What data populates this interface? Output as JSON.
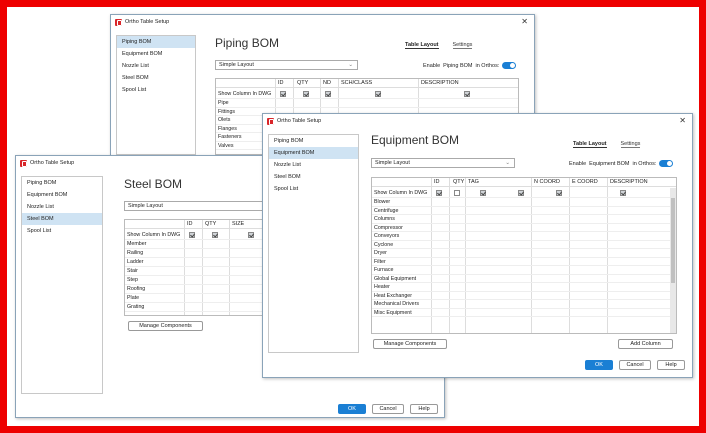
{
  "app_title": "Ortho Table Setup",
  "nav": [
    "Piping BOM",
    "Equipment BOM",
    "Nozzle List",
    "Steel BOM",
    "Spool List"
  ],
  "tab_table": "Table Layout",
  "tab_settings": "Settings",
  "layout": "Simple Layout",
  "show_col": "Show Column In DWG",
  "enable_prefix": "Enable",
  "enable_suffix": "in Orthos:",
  "piping": {
    "title": "Piping BOM",
    "cols": [
      "ID",
      "QTY",
      "ND",
      "SCH/CLASS",
      "DESCRIPTION"
    ],
    "rows": [
      "Pipe",
      "Fittings",
      "Olets",
      "Flanges",
      "Fasteners",
      "Valves"
    ]
  },
  "steel": {
    "title": "Steel BOM",
    "cols": [
      "ID",
      "QTY",
      "SIZE"
    ],
    "rows": [
      "Member",
      "Railing",
      "Ladder",
      "Stair",
      "Step",
      "Roofing",
      "Plate",
      "Grating"
    ],
    "manage": "Manage Components",
    "ok": "OK",
    "cancel": "Cancel",
    "help": "Help"
  },
  "equip": {
    "title": "Equipment BOM",
    "cols": [
      "ID",
      "QTY",
      "TAG",
      "N COORD",
      "E COORD",
      "DESCRIPTION"
    ],
    "rows": [
      "Blower",
      "Centrifuge",
      "Columns",
      "Compressor",
      "Conveyors",
      "Cyclone",
      "Dryer",
      "Filter",
      "Furnace",
      "Global Equipment",
      "Heater",
      "Heat Exchanger",
      "Mechanical Drivers",
      "Misc Equipment"
    ],
    "manage": "Manage Components",
    "add": "Add Column",
    "ok": "OK",
    "cancel": "Cancel",
    "help": "Help"
  }
}
